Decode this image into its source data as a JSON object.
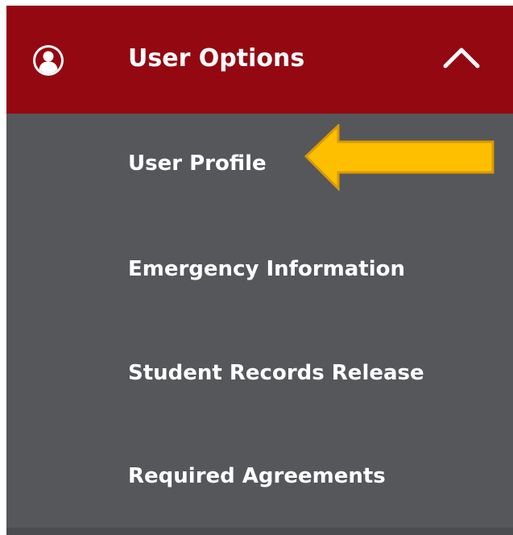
{
  "menu": {
    "title": "User Options",
    "icon": "user-circle-icon",
    "toggle_icon": "chevron-up-icon",
    "colors": {
      "header_background": "#940812",
      "body_background": "#55575b",
      "text": "#ffffff",
      "annotation_arrow": "#fdbf00"
    },
    "items": [
      {
        "label": "User Profile"
      },
      {
        "label": "Emergency Information"
      },
      {
        "label": "Student Records Release"
      },
      {
        "label": "Required Agreements"
      }
    ]
  },
  "annotation": {
    "icon": "arrow-left-icon",
    "points_to": "User Profile"
  }
}
